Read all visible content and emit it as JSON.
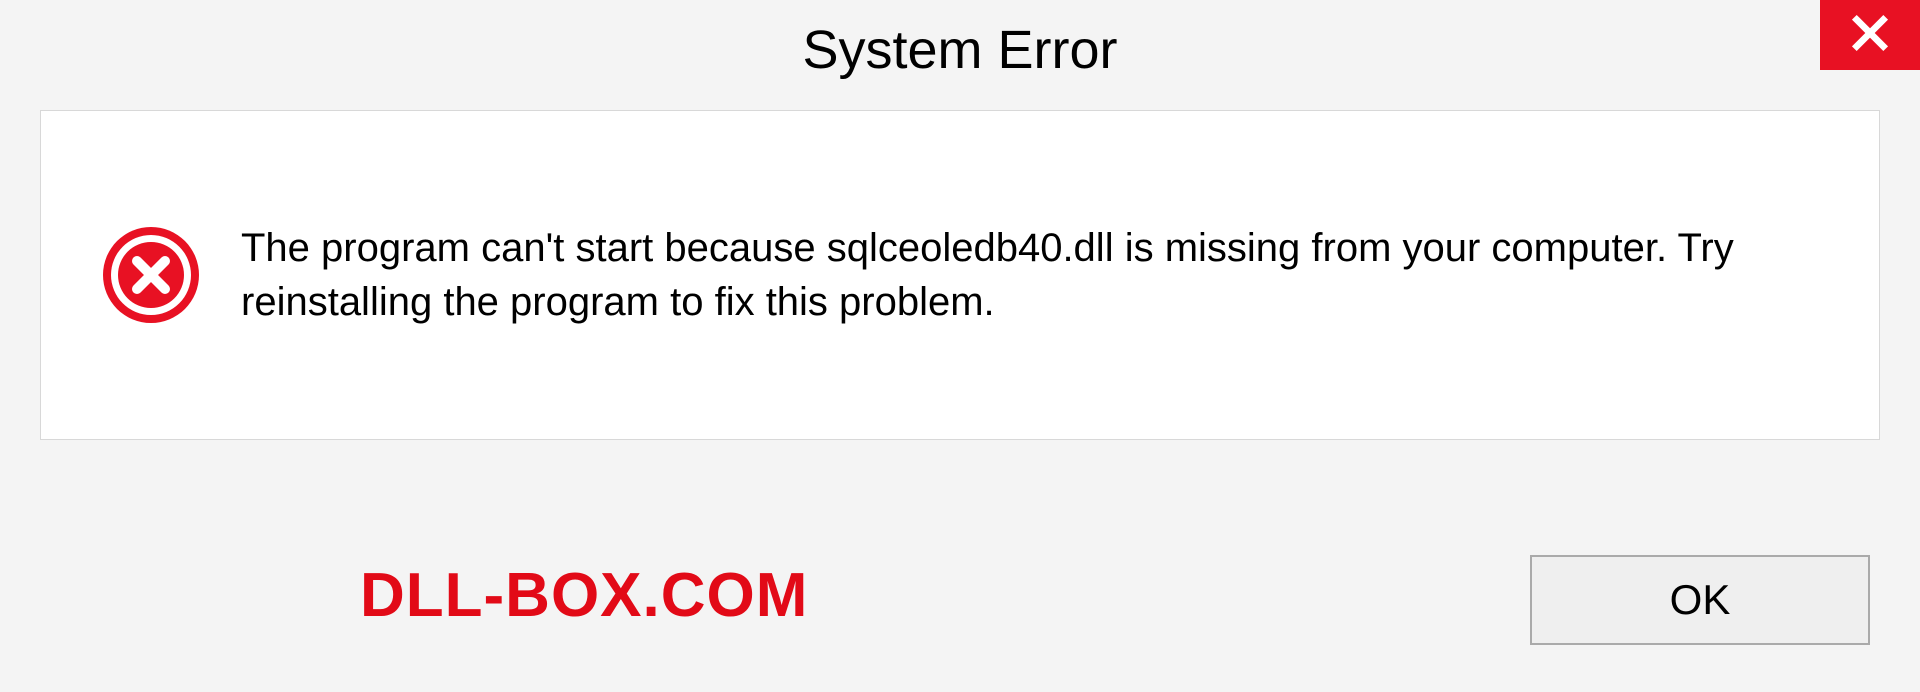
{
  "titlebar": {
    "title": "System Error"
  },
  "dialog": {
    "message": "The program can't start because sqlceoledb40.dll is missing from your computer. Try reinstalling the program to fix this problem."
  },
  "footer": {
    "watermark": "DLL-BOX.COM",
    "ok_label": "OK"
  }
}
